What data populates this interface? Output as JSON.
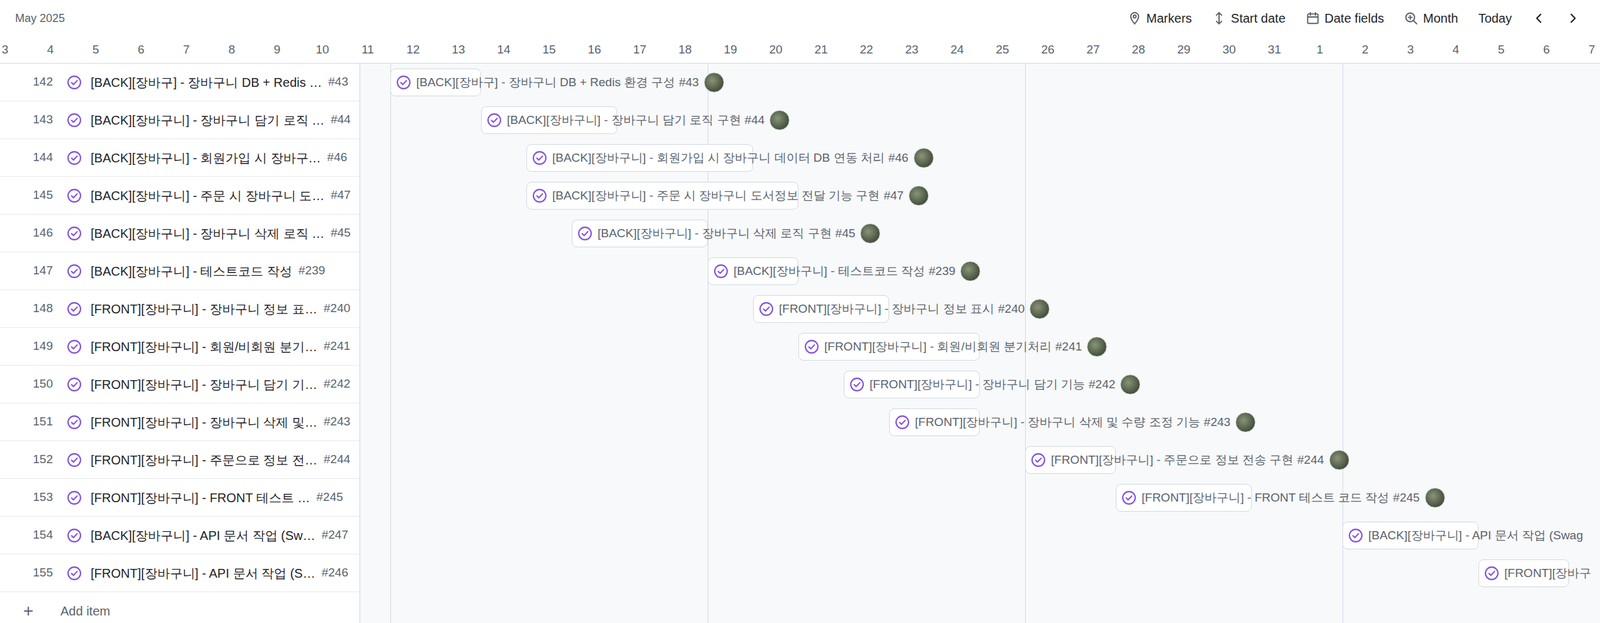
{
  "toolbar": {
    "month": "May 2025",
    "controls": [
      {
        "label": "Markers"
      },
      {
        "label": "Start date"
      },
      {
        "label": "Date fields"
      },
      {
        "label": "Month"
      }
    ],
    "today": "Today"
  },
  "days": [
    "3",
    "4",
    "5",
    "6",
    "7",
    "8",
    "9",
    "10",
    "11",
    "12",
    "13",
    "14",
    "15",
    "16",
    "17",
    "18",
    "19",
    "20",
    "21",
    "22",
    "23",
    "24",
    "25",
    "26",
    "27",
    "28",
    "29",
    "30",
    "31",
    "1",
    "2",
    "3",
    "4",
    "5",
    "6",
    "7"
  ],
  "rows": [
    {
      "number": "142",
      "title": "[BACK][장바구] - 장바구니 DB + Redis …",
      "ref": "#43",
      "closed": true,
      "bar": {
        "title": "[BACK][장바구] - 장바구니 DB + Redis 환경 구성",
        "ref": "#43",
        "dates": [
          "2025-05-12",
          "2025-05-13"
        ],
        "avatar": true
      }
    },
    {
      "number": "143",
      "title": "[BACK][장바구니] - 장바구니 담기 로직 …",
      "ref": "#44",
      "closed": true,
      "bar": {
        "title": "[BACK][장바구니] - 장바구니 담기 로직 구현",
        "ref": "#44",
        "dates": [
          "2025-05-14",
          "2025-05-16"
        ],
        "avatar": true
      }
    },
    {
      "number": "144",
      "title": "[BACK][장바구니] - 회원가입 시 장바구…",
      "ref": "#46",
      "closed": true,
      "bar": {
        "title": "[BACK][장바구니] - 회원가입 시 장바구니 데이터 DB 연동 처리",
        "ref": "#46",
        "dates": [
          "2025-05-15",
          "2025-05-19"
        ],
        "avatar": true
      }
    },
    {
      "number": "145",
      "title": "[BACK][장바구니] - 주문 시 장바구니 도…",
      "ref": "#47",
      "closed": true,
      "bar": {
        "title": "[BACK][장바구니] - 주문 시 장바구니 도서정보 전달 기능 구현",
        "ref": "#47",
        "dates": [
          "2025-05-15",
          "2025-05-20"
        ],
        "avatar": true
      }
    },
    {
      "number": "146",
      "title": "[BACK][장바구니] - 장바구니 삭제 로직 …",
      "ref": "#45",
      "closed": true,
      "bar": {
        "title": "[BACK][장바구니] - 장바구니 삭제 로직 구현",
        "ref": "#45",
        "dates": [
          "2025-05-16",
          "2025-05-18"
        ],
        "avatar": true
      }
    },
    {
      "number": "147",
      "title": "[BACK][장바구니] - 테스트코드 작성",
      "ref": "#239",
      "closed": true,
      "bar": {
        "title": "[BACK][장바구니] - 테스트코드 작성",
        "ref": "#239",
        "dates": [
          "2025-05-19",
          "2025-05-20"
        ],
        "avatar": true
      }
    },
    {
      "number": "148",
      "title": "[FRONT][장바구니] - 장바구니 정보 표…",
      "ref": "#240",
      "closed": true,
      "bar": {
        "title": "[FRONT][장바구니] - 장바구니 정보 표시",
        "ref": "#240",
        "dates": [
          "2025-05-20",
          "2025-05-22"
        ],
        "avatar": true
      }
    },
    {
      "number": "149",
      "title": "[FRONT][장바구니] - 회원/비회원 분기…",
      "ref": "#241",
      "closed": true,
      "bar": {
        "title": "[FRONT][장바구니] - 회원/비회원 분기처리",
        "ref": "#241",
        "dates": [
          "2025-05-21",
          "2025-05-24"
        ],
        "avatar": true
      }
    },
    {
      "number": "150",
      "title": "[FRONT][장바구니] - 장바구니 담기 기…",
      "ref": "#242",
      "closed": true,
      "bar": {
        "title": "[FRONT][장바구니] - 장바구니 담기 기능",
        "ref": "#242",
        "dates": [
          "2025-05-22",
          "2025-05-24"
        ],
        "avatar": true
      }
    },
    {
      "number": "151",
      "title": "[FRONT][장바구니] - 장바구니 삭제 및…",
      "ref": "#243",
      "closed": true,
      "bar": {
        "title": "[FRONT][장바구니] - 장바구니 삭제 및 수량 조정 기능",
        "ref": "#243",
        "dates": [
          "2025-05-23",
          "2025-05-24"
        ],
        "avatar": true
      }
    },
    {
      "number": "152",
      "title": "[FRONT][장바구니] - 주문으로 정보 전…",
      "ref": "#244",
      "closed": true,
      "bar": {
        "title": "[FRONT][장바구니] - 주문으로 정보 전송 구현",
        "ref": "#244",
        "dates": [
          "2025-05-26",
          "2025-05-27"
        ],
        "avatar": true
      }
    },
    {
      "number": "153",
      "title": "[FRONT][장바구니] - FRONT 테스트 …",
      "ref": "#245",
      "closed": true,
      "bar": {
        "title": "[FRONT][장바구니] - FRONT 테스트 코드 작성",
        "ref": "#245",
        "dates": [
          "2025-05-28",
          "2025-05-30"
        ],
        "avatar": true
      }
    },
    {
      "number": "154",
      "title": "[BACK][장바구니] - API 문서 작업 (Sw…",
      "ref": "#247",
      "closed": true,
      "bar": {
        "title": "[BACK][장바구니] - API 문서 작업 (Swag",
        "dates": [
          "2025-06-02",
          "2025-06-04"
        ],
        "avatar": false
      }
    },
    {
      "number": "155",
      "title": "[FRONT][장바구니] - API 문서 작업 (S…",
      "ref": "#246",
      "closed": true,
      "bar": {
        "title": "[FRONT][장바구",
        "dates": [
          "2025-06-05",
          "2025-06-06"
        ],
        "avatar": false
      }
    }
  ],
  "add_item": {
    "icon": "+",
    "label": "Add item"
  }
}
